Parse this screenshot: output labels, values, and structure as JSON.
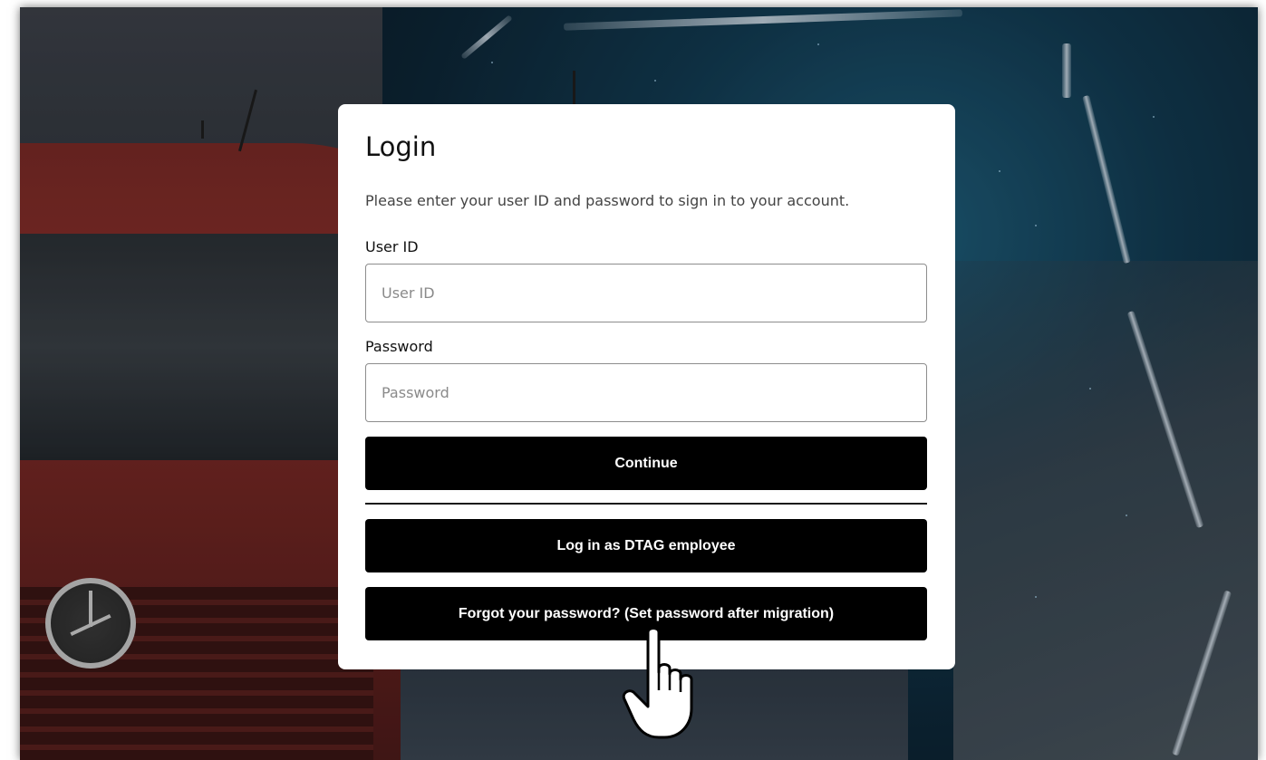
{
  "login": {
    "title": "Login",
    "description": "Please enter your user ID and password to sign in to your account.",
    "user_id_label": "User ID",
    "user_id_placeholder": "User ID",
    "user_id_value": "",
    "password_label": "Password",
    "password_placeholder": "Password",
    "password_value": "",
    "continue_label": "Continue",
    "dtag_label": "Log in as DTAG employee",
    "forgot_label": "Forgot your password? (Set password after migration)"
  },
  "colors": {
    "button_bg": "#000000",
    "button_text": "#ffffff",
    "card_bg": "#ffffff",
    "truck_red": "#8a2f2b",
    "bg_blue": "#1f5f7c"
  },
  "icons": {
    "cursor": "pointing-hand-icon",
    "logo": "mercedes-star-logo"
  }
}
